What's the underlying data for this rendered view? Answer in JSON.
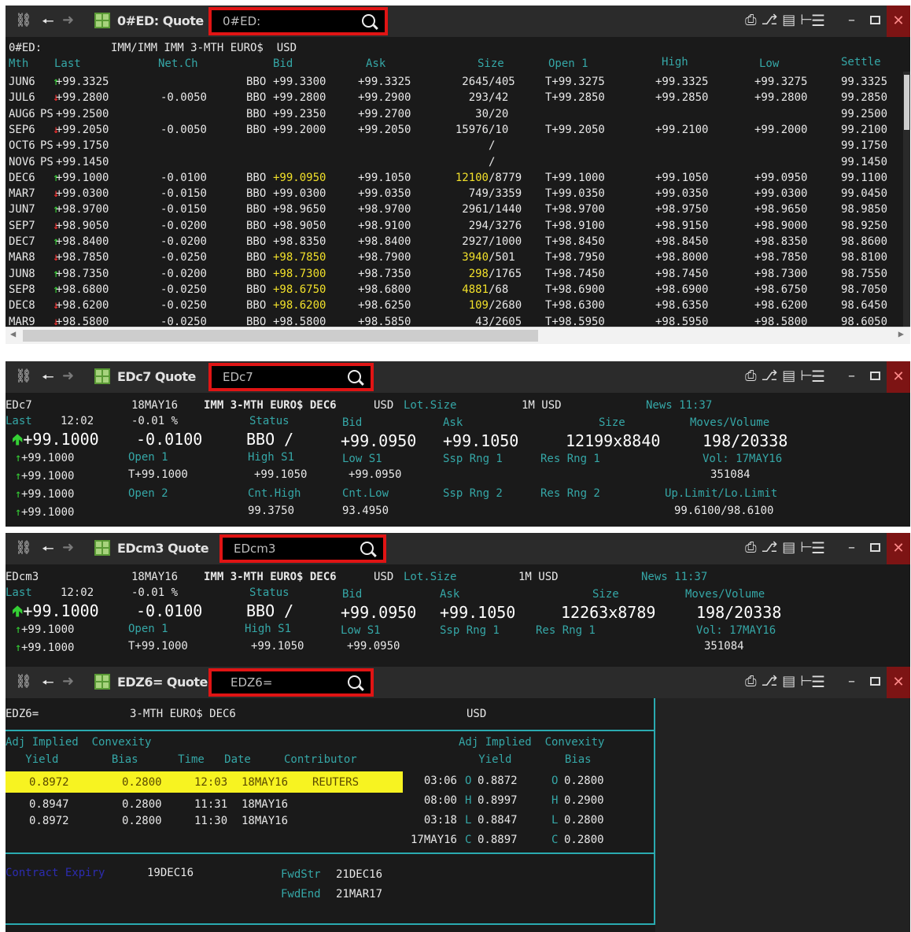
{
  "win1": {
    "title": "0#ED: Quote",
    "search": "0#ED:",
    "hdr_sym": "0#ED:",
    "hdr_desc": "IMM/IMM IMM 3-MTH EURO$  USD",
    "cols": {
      "mth": "Mth",
      "last": "Last",
      "netch": "Net.Ch",
      "bid": "Bid",
      "ask": "Ask",
      "size": "Size",
      "open": "Open 1",
      "high": "High",
      "low": "Low",
      "settle": "Settle"
    },
    "rows": [
      {
        "mth": "JUN6",
        "ind": "↑",
        "last": "+99.3325",
        "netch": "",
        "bidpre": "BBO",
        "bid": "+99.3300",
        "ask": "+99.3325",
        "sz1": "2645",
        "sz2": "/405",
        "open": "T+99.3275",
        "high": "+99.3325",
        "low": "+99.3275",
        "settle": "99.3325"
      },
      {
        "mth": "JUL6",
        "ind": "↓",
        "last": "+99.2800",
        "netch": "-0.0050",
        "bidpre": "BBO",
        "bid": "+99.2800",
        "ask": "+99.2900",
        "sz1": "293",
        "sz2": "/42",
        "open": "T+99.2850",
        "high": "+99.2850",
        "low": "+99.2800",
        "settle": "99.2850"
      },
      {
        "mth": "AUG6",
        "ind": "PS",
        "last": "+99.2500",
        "netch": "",
        "bidpre": "BBO",
        "bid": "+99.2350",
        "ask": "+99.2700",
        "sz1": "30",
        "sz2": "/20",
        "open": "",
        "high": "",
        "low": "",
        "settle": "99.2500"
      },
      {
        "mth": "SEP6",
        "ind": "↓",
        "last": "+99.2050",
        "netch": "-0.0050",
        "bidpre": "BBO",
        "bid": "+99.2000",
        "ask": "+99.2050",
        "sz1": "15976",
        "sz2": "/10",
        "open": "T+99.2050",
        "high": "+99.2100",
        "low": "+99.2000",
        "settle": "99.2100"
      },
      {
        "mth": "OCT6",
        "ind": "PS",
        "last": "+99.1750",
        "netch": "",
        "bidpre": "",
        "bid": "",
        "ask": "",
        "sz1": "",
        "sz2": "/",
        "open": "",
        "high": "",
        "low": "",
        "settle": "99.1750"
      },
      {
        "mth": "NOV6",
        "ind": "PS",
        "last": "+99.1450",
        "netch": "",
        "bidpre": "",
        "bid": "",
        "ask": "",
        "sz1": "",
        "sz2": "/",
        "open": "",
        "high": "",
        "low": "",
        "settle": "99.1450"
      },
      {
        "mth": "DEC6",
        "ind": "↑",
        "last": "+99.1000",
        "netch": "-0.0100",
        "bidpre": "BBO",
        "bid": "+99.0950",
        "ask": "+99.1050",
        "sz1": "12100",
        "sz2": "/8779",
        "open": "T+99.1000",
        "high": "+99.1050",
        "low": "+99.0950",
        "settle": "99.1100",
        "hl": true
      },
      {
        "mth": "MAR7",
        "ind": "↓",
        "last": "+99.0300",
        "netch": "-0.0150",
        "bidpre": "BBO",
        "bid": "+99.0300",
        "ask": "+99.0350",
        "sz1": "749",
        "sz2": "/3359",
        "open": "T+99.0350",
        "high": "+99.0350",
        "low": "+99.0300",
        "settle": "99.0450"
      },
      {
        "mth": "JUN7",
        "ind": "↑",
        "last": "+98.9700",
        "netch": "-0.0150",
        "bidpre": "BBO",
        "bid": "+98.9650",
        "ask": "+98.9700",
        "sz1": "2961",
        "sz2": "/1440",
        "open": "T+98.9700",
        "high": "+98.9750",
        "low": "+98.9650",
        "settle": "98.9850"
      },
      {
        "mth": "SEP7",
        "ind": "↓",
        "last": "+98.9050",
        "netch": "-0.0200",
        "bidpre": "BBO",
        "bid": "+98.9050",
        "ask": "+98.9100",
        "sz1": "294",
        "sz2": "/3276",
        "open": "T+98.9100",
        "high": "+98.9150",
        "low": "+98.9000",
        "settle": "98.9250"
      },
      {
        "mth": "DEC7",
        "ind": "↑",
        "last": "+98.8400",
        "netch": "-0.0200",
        "bidpre": "BBO",
        "bid": "+98.8350",
        "ask": "+98.8400",
        "sz1": "2927",
        "sz2": "/1000",
        "open": "T+98.8450",
        "high": "+98.8450",
        "low": "+98.8350",
        "settle": "98.8600"
      },
      {
        "mth": "MAR8",
        "ind": "↓",
        "last": "+98.7850",
        "netch": "-0.0250",
        "bidpre": "BBO",
        "bid": "+98.7850",
        "ask": "+98.7900",
        "sz1": "3940",
        "sz2": "/501",
        "open": "T+98.7950",
        "high": "+98.8000",
        "low": "+98.7850",
        "settle": "98.8100",
        "hl": true
      },
      {
        "mth": "JUN8",
        "ind": "↑",
        "last": "+98.7350",
        "netch": "-0.0200",
        "bidpre": "BBO",
        "bid": "+98.7300",
        "ask": "+98.7350",
        "sz1": "298",
        "sz2": "/1765",
        "open": "T+98.7450",
        "high": "+98.7450",
        "low": "+98.7300",
        "settle": "98.7550",
        "hl": true
      },
      {
        "mth": "SEP8",
        "ind": "↑",
        "last": "+98.6800",
        "netch": "-0.0250",
        "bidpre": "BBO",
        "bid": "+98.6750",
        "ask": "+98.6800",
        "sz1": "4881",
        "sz2": "/68",
        "open": "T+98.6900",
        "high": "+98.6900",
        "low": "+98.6750",
        "settle": "98.7050",
        "hl": true
      },
      {
        "mth": "DEC8",
        "ind": "↓",
        "last": "+98.6200",
        "netch": "-0.0250",
        "bidpre": "BBO",
        "bid": "+98.6200",
        "ask": "+98.6250",
        "sz1": "109",
        "sz2": "/2680",
        "open": "T+98.6300",
        "high": "+98.6350",
        "low": "+98.6200",
        "settle": "98.6450",
        "hl": true
      },
      {
        "mth": "MAR9",
        "ind": "↓",
        "last": "+98.5800",
        "netch": "-0.0250",
        "bidpre": "BBO",
        "bid": "+98.5800",
        "ask": "+98.5850",
        "sz1": "43",
        "sz2": "/2605",
        "open": "T+98.5950",
        "high": "+98.5950",
        "low": "+98.5800",
        "settle": "98.6050"
      }
    ]
  },
  "win2": {
    "title": "EDc7 Quote",
    "search": "EDc7",
    "sym": "EDc7",
    "date": "18MAY16",
    "desc": "IMM 3-MTH EURO$ DEC6",
    "ccy": "USD",
    "lot_label": "Lot.Size",
    "lot": "1M USD",
    "news": "News 11:37",
    "last_label": "Last",
    "time": "12:02",
    "pct": "-0.01 %",
    "status_label": "Status",
    "bid_label": "Bid",
    "ask_label": "Ask",
    "size_label": "Size",
    "mv_label": "Moves/Volume",
    "last_big": "+99.1000",
    "netch_big": "-0.0100",
    "bbo": "BBO /",
    "bid_big": "+99.0950",
    "ask_big": "+99.1050",
    "size_big": "12199x8840",
    "mv_big": "198/20338",
    "hist": [
      "+99.1000",
      "+99.1000",
      "+99.1000",
      "+99.1000"
    ],
    "open1_label": "Open 1",
    "open1": "T+99.1000",
    "high_label": "High S1",
    "high": "+99.1050",
    "low_label": "Low S1",
    "low": "+99.0950",
    "ssp1": "Ssp Rng 1",
    "res1": "Res Rng 1",
    "vol_label": "Vol: 17MAY16",
    "vol": "351084",
    "open2_label": "Open 2",
    "cnthi_label": "Cnt.High",
    "cnthi": "99.3750",
    "cntlo_label": "Cnt.Low",
    "cntlo": "93.4950",
    "ssp2": "Ssp Rng 2",
    "res2": "Res Rng 2",
    "lim_label": "Up.Limit/Lo.Limit",
    "lim": "99.6100/98.6100"
  },
  "win3": {
    "title": "EDcm3 Quote",
    "search": "EDcm3",
    "sym": "EDcm3",
    "date": "18MAY16",
    "desc": "IMM 3-MTH EURO$ DEC6",
    "ccy": "USD",
    "lot_label": "Lot.Size",
    "lot": "1M USD",
    "news": "News 11:37",
    "last_label": "Last",
    "time": "12:02",
    "pct": "-0.01 %",
    "status_label": "Status",
    "bid_label": "Bid",
    "ask_label": "Ask",
    "size_label": "Size",
    "mv_label": "Moves/Volume",
    "last_big": "+99.1000",
    "netch_big": "-0.0100",
    "bbo": "BBO /",
    "bid_big": "+99.0950",
    "ask_big": "+99.1050",
    "size_big": "12263x8789",
    "mv_big": "198/20338",
    "hist": [
      "+99.1000",
      "+99.1000"
    ],
    "open1_label": "Open 1",
    "open1": "T+99.1000",
    "high_label": "High S1",
    "high": "+99.1050",
    "low_label": "Low S1",
    "low": "+99.0950",
    "ssp1": "Ssp Rng 1",
    "res1": "Res Rng 1",
    "vol_label": "Vol: 17MAY16",
    "vol": "351084"
  },
  "win4": {
    "title": "EDZ6= Quote",
    "search": "EDZ6=",
    "sym": "EDZ6=",
    "desc": "3-MTH EURO$ DEC6",
    "ccy": "USD",
    "l_h1": "Adj Implied  Convexity",
    "l_h2": "   Yield        Bias      Time   Date     Contributor",
    "r_h1": "Adj Implied  Convexity",
    "r_h2": "   Yield        Bias",
    "left_rows": [
      {
        "yield": "0.8972",
        "bias": "0.2800",
        "time": "12:03",
        "date": "18MAY16",
        "contrib": "REUTERS"
      },
      {
        "yield": "0.8947",
        "bias": "0.2800",
        "time": "11:31",
        "date": "18MAY16",
        "contrib": ""
      },
      {
        "yield": "0.8972",
        "bias": "0.2800",
        "time": "11:30",
        "date": "18MAY16",
        "contrib": ""
      }
    ],
    "right_rows": [
      {
        "time": "03:06",
        "k1": "O",
        "yield": "0.8872",
        "k2": "O",
        "bias": "0.2800"
      },
      {
        "time": "08:00",
        "k1": "H",
        "yield": "0.8997",
        "k2": "H",
        "bias": "0.2900"
      },
      {
        "time": "03:18",
        "k1": "L",
        "yield": "0.8847",
        "k2": "L",
        "bias": "0.2800"
      },
      {
        "time": "17MAY16",
        "k1": "C",
        "yield": "0.8897",
        "k2": "C",
        "bias": "0.2800"
      }
    ],
    "expiry_label": "Contract Expiry",
    "expiry": "19DEC16",
    "fwdstr_label": "FwdStr",
    "fwdstr": "21DEC16",
    "fwdend_label": "FwdEnd",
    "fwdend": "21MAR17"
  },
  "colors": {
    "accent_red": "#e01414",
    "highlight_yellow": "#f7f321",
    "teal": "#35a7a7",
    "up_green": "#35d035",
    "down_red": "#ff3030"
  }
}
